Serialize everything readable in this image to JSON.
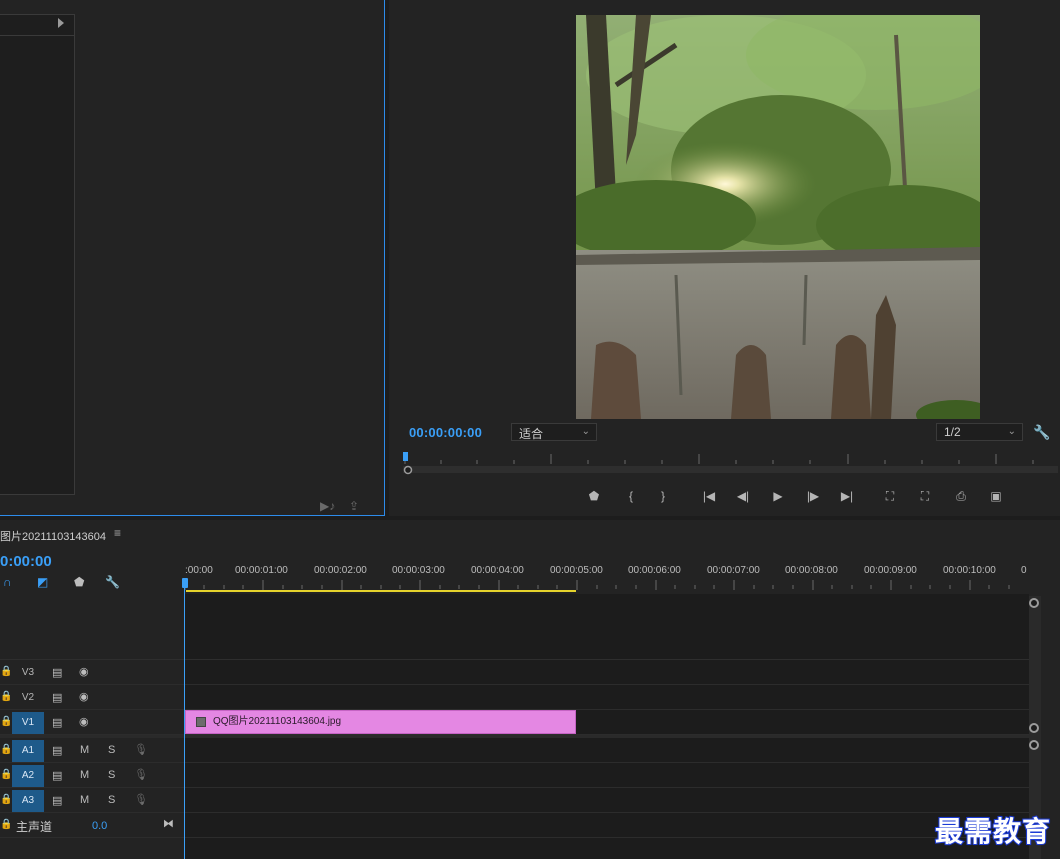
{
  "source": {
    "buttons": [
      "▶♪",
      "⇪"
    ]
  },
  "program": {
    "timecode": "00:00:00:00",
    "fit_dropdown": "适合",
    "resolution_dropdown": "1/2",
    "transport": {
      "marker_icon": "marker-icon",
      "in_icon": "mark-in-icon",
      "out_icon": "mark-out-icon",
      "goto_in_icon": "go-to-in-icon",
      "step_back_icon": "step-back-icon",
      "play_icon": "play-icon",
      "step_forward_icon": "step-forward-icon",
      "goto_out_icon": "go-to-out-icon",
      "lift_icon": "lift-icon",
      "extract_icon": "extract-icon",
      "export_frame_icon": "camera-icon",
      "compare_icon": "compare-icon"
    }
  },
  "timeline": {
    "sequence_name": "图片20211103143604",
    "menu_glyph": "≡",
    "timecode": "0:00:00",
    "ruler_labels": [
      ":00:00",
      "00:00:01:00",
      "00:00:02:00",
      "00:00:03:00",
      "00:00:04:00",
      "00:00:05:00",
      "00:00:06:00",
      "00:00:07:00",
      "00:00:08:00",
      "00:00:09:00",
      "00:00:10:00",
      "0"
    ],
    "tracks": {
      "video": [
        {
          "label": "V3",
          "active": false
        },
        {
          "label": "V2",
          "active": false
        },
        {
          "label": "V1",
          "active": true
        }
      ],
      "audio": [
        {
          "label": "A1",
          "m": "M",
          "s": "S"
        },
        {
          "label": "A2",
          "m": "M",
          "s": "S"
        },
        {
          "label": "A3",
          "m": "M",
          "s": "S"
        }
      ]
    },
    "master": {
      "label": "主声道",
      "value": "0.0"
    },
    "clip": {
      "name": "QQ图片20211103143604.jpg",
      "color": "#e487e3"
    },
    "work_area_color": "#e5d32c"
  },
  "watermark": "最需教育"
}
